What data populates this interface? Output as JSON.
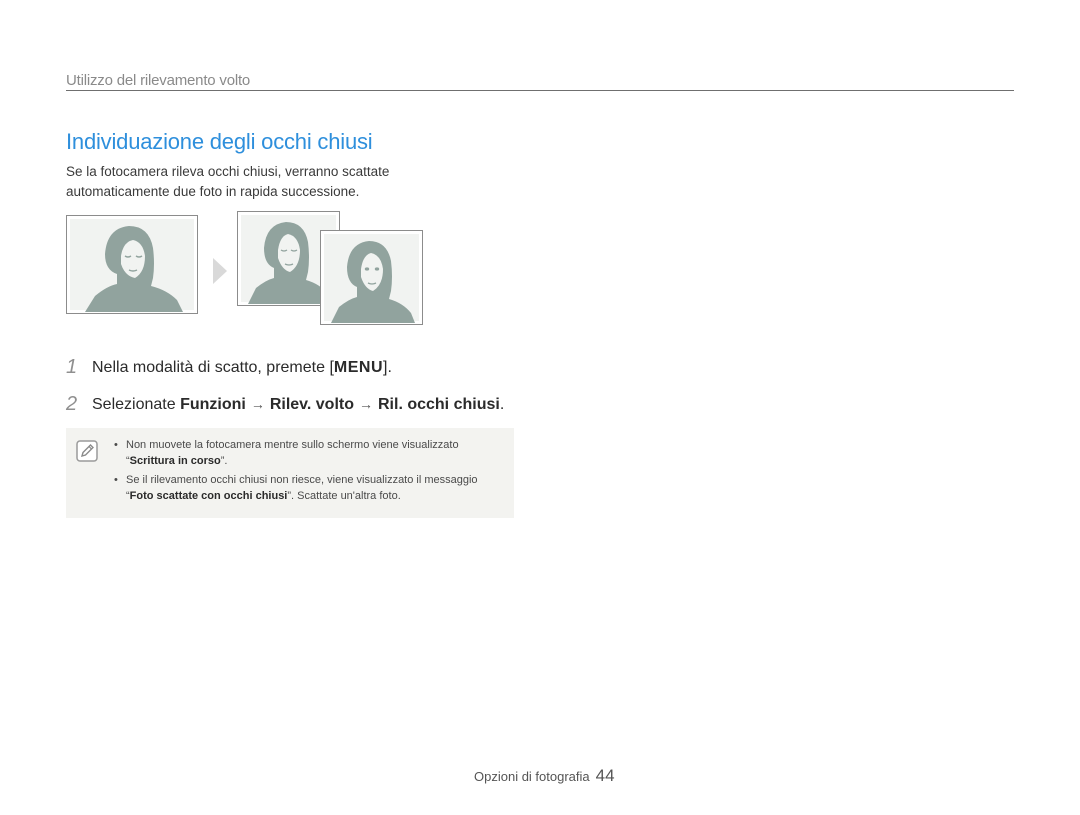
{
  "header": {
    "section": "Utilizzo del rilevamento volto"
  },
  "title": "Individuazione degli occhi chiusi",
  "intro": "Se la fotocamera rileva occhi chiusi, verranno scattate automaticamente due foto in rapida successione.",
  "illustration": {
    "icons": [
      "portrait-eyes-closed",
      "arrow-right",
      "portrait-eyes-closed",
      "portrait-eyes-open"
    ],
    "colors": {
      "silhouette": "#91a39e",
      "frame": "#8c8c8c",
      "arrow": "#d9d9d9"
    }
  },
  "steps": [
    {
      "num": "1",
      "text_before": "Nella modalità di scatto, premete [",
      "key": "MENU",
      "text_after": "]."
    },
    {
      "num": "2",
      "text_before": "Selezionate ",
      "path": [
        "Funzioni",
        "Rilev. volto",
        "Ril. occhi chiusi"
      ],
      "separator": "→",
      "text_after": "."
    }
  ],
  "notes": {
    "icon": "note-pencil-icon",
    "bullet": "•",
    "items": [
      {
        "before": "Non muovete la fotocamera mentre sullo schermo viene visualizzato “",
        "bold": "Scrittura in corso",
        "after": "”."
      },
      {
        "before": "Se il rilevamento occhi chiusi non riesce, viene visualizzato il messaggio “",
        "bold": "Foto scattate con occhi chiusi",
        "after": "”. Scattate un'altra foto."
      }
    ]
  },
  "footer": {
    "label": "Opzioni di fotografia",
    "page": "44"
  }
}
